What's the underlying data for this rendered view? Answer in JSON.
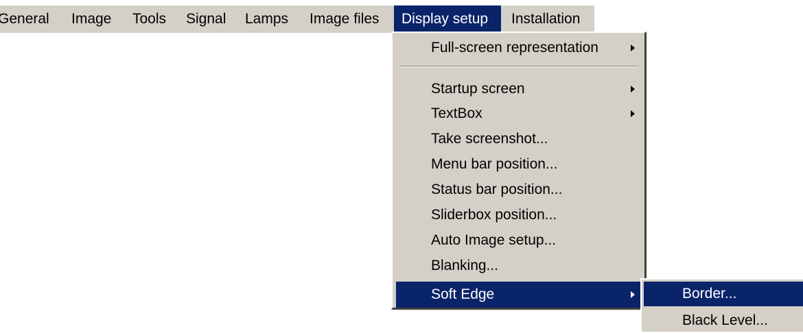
{
  "menubar": {
    "items": [
      {
        "label": "General"
      },
      {
        "label": "Image"
      },
      {
        "label": "Tools"
      },
      {
        "label": "Signal"
      },
      {
        "label": "Lamps"
      },
      {
        "label": "Image files"
      },
      {
        "label": "Display setup"
      },
      {
        "label": "Installation"
      }
    ],
    "active": "Display setup"
  },
  "dropdown": {
    "items": [
      {
        "label": "Full-screen representation",
        "submenu": true
      },
      {
        "label": "Startup screen",
        "submenu": true
      },
      {
        "label": "TextBox",
        "submenu": true
      },
      {
        "label": "Take screenshot..."
      },
      {
        "label": "Menu bar position..."
      },
      {
        "label": "Status bar position..."
      },
      {
        "label": "Sliderbox position..."
      },
      {
        "label": "Auto Image setup..."
      },
      {
        "label": "Blanking..."
      },
      {
        "label": "Soft Edge",
        "submenu": true,
        "highlighted": true
      }
    ]
  },
  "submenu": {
    "parent": "Soft Edge",
    "items": [
      {
        "label": "Border...",
        "highlighted": true
      },
      {
        "label": "Black Level..."
      }
    ]
  },
  "colors": {
    "menu_face": "#d4d0c8",
    "highlight": "#0a246a",
    "highlight_text": "#ffffff",
    "text": "#000000"
  }
}
